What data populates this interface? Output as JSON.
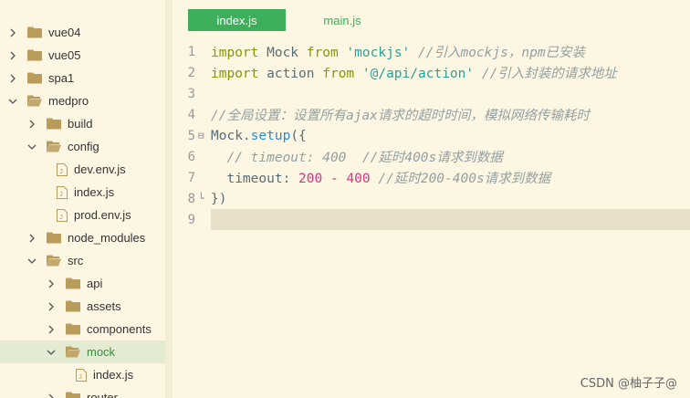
{
  "sidebar": {
    "items": [
      {
        "label": "vue04",
        "type": "folder",
        "state": "collapsed",
        "depth": 0
      },
      {
        "label": "vue05",
        "type": "folder",
        "state": "collapsed",
        "depth": 0
      },
      {
        "label": "spa1",
        "type": "folder",
        "state": "collapsed",
        "depth": 0
      },
      {
        "label": "medpro",
        "type": "folder",
        "state": "expanded",
        "depth": 0
      },
      {
        "label": "build",
        "type": "folder",
        "state": "collapsed",
        "depth": 1
      },
      {
        "label": "config",
        "type": "folder",
        "state": "expanded",
        "depth": 1
      },
      {
        "label": "dev.env.js",
        "type": "file",
        "depth": 2
      },
      {
        "label": "index.js",
        "type": "file",
        "depth": 2
      },
      {
        "label": "prod.env.js",
        "type": "file",
        "depth": 2
      },
      {
        "label": "node_modules",
        "type": "folder",
        "state": "collapsed",
        "depth": 1
      },
      {
        "label": "src",
        "type": "folder",
        "state": "expanded",
        "depth": 1
      },
      {
        "label": "api",
        "type": "folder",
        "state": "collapsed",
        "depth": 2
      },
      {
        "label": "assets",
        "type": "folder",
        "state": "collapsed",
        "depth": 2
      },
      {
        "label": "components",
        "type": "folder",
        "state": "collapsed",
        "depth": 2
      },
      {
        "label": "mock",
        "type": "folder",
        "state": "expanded",
        "depth": 2,
        "selected": true
      },
      {
        "label": "index.js",
        "type": "file",
        "depth": 3
      },
      {
        "label": "router",
        "type": "folder",
        "state": "collapsed",
        "depth": 2
      }
    ]
  },
  "tabs": [
    {
      "label": "index.js",
      "active": true
    },
    {
      "label": "main.js",
      "active": false
    }
  ],
  "code": {
    "lines": [
      {
        "n": "1",
        "tokens": [
          [
            "kw",
            "import"
          ],
          [
            "plain",
            " Mock "
          ],
          [
            "kw",
            "from"
          ],
          [
            "plain",
            " "
          ],
          [
            "str",
            "'mockjs'"
          ],
          [
            "plain",
            " "
          ],
          [
            "cm",
            "//引入mockjs，npm已安装"
          ]
        ]
      },
      {
        "n": "2",
        "tokens": [
          [
            "kw",
            "import"
          ],
          [
            "plain",
            " action "
          ],
          [
            "kw",
            "from"
          ],
          [
            "plain",
            " "
          ],
          [
            "str",
            "'@/api/action'"
          ],
          [
            "plain",
            " "
          ],
          [
            "cm",
            "//引入封装的请求地址"
          ]
        ]
      },
      {
        "n": "3",
        "tokens": []
      },
      {
        "n": "4",
        "tokens": [
          [
            "cm",
            "//全局设置：设置所有ajax请求的超时时间，模拟网络传输耗时"
          ]
        ]
      },
      {
        "n": "5",
        "fold": "⊟",
        "tokens": [
          [
            "plain",
            "Mock."
          ],
          [
            "fn",
            "setup"
          ],
          [
            "plain",
            "({"
          ]
        ]
      },
      {
        "n": "6",
        "tokens": [
          [
            "plain",
            "  "
          ],
          [
            "cm",
            "// timeout: 400  //延时400s请求到数据"
          ]
        ]
      },
      {
        "n": "7",
        "tokens": [
          [
            "plain",
            "  timeout: "
          ],
          [
            "num",
            "200"
          ],
          [
            "plain",
            " "
          ],
          [
            "op",
            "-"
          ],
          [
            "plain",
            " "
          ],
          [
            "num",
            "400"
          ],
          [
            "plain",
            " "
          ],
          [
            "cm",
            "//延时200-400s请求到数据"
          ]
        ]
      },
      {
        "n": "8",
        "fold": "└",
        "tokens": [
          [
            "plain",
            "})"
          ]
        ]
      },
      {
        "n": "9",
        "current": true,
        "tokens": []
      }
    ]
  },
  "watermark": "CSDN @柚子子@",
  "colors": {
    "background": "#fdf6e3",
    "tab_active": "#3daf5a",
    "folder": "#b99b5a",
    "selected_row": "#e3ebd3"
  }
}
